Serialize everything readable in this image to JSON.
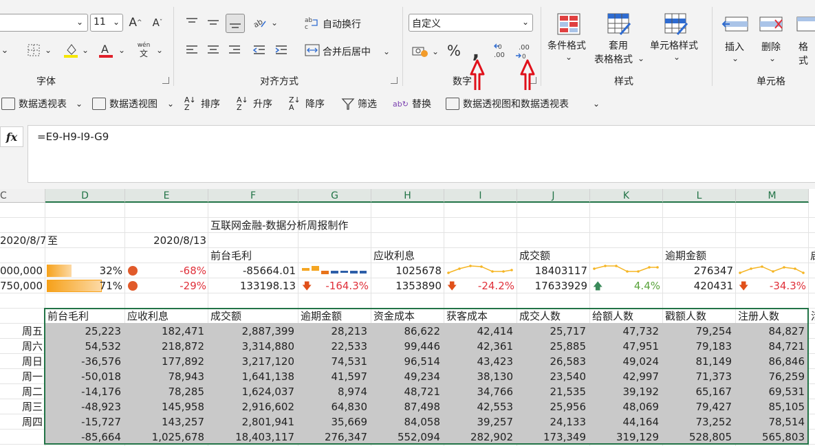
{
  "ribbon": {
    "font_size": "11",
    "font_group_label": "字体",
    "align_group_label": "对齐方式",
    "wrap_text": "自动换行",
    "merge_center": "合并后居中",
    "number_format": "自定义",
    "number_group_label": "数字",
    "percent_symbol": "%",
    "comma_symbol": ",",
    "inc_decimal": ".00",
    "dec_decimal": ".00",
    "wen_label": "wén",
    "cond_format": "条件格式",
    "table_format_1": "套用",
    "table_format_2": "表格格式",
    "cell_style": "单元格样式",
    "styles_group_label": "样式",
    "insert": "插入",
    "delete": "删除",
    "format": "格式",
    "cells_group_label": "单元格"
  },
  "quickbar": {
    "pivot_table": "数据透视表",
    "pivot_chart": "数据透视图",
    "sort": "排序",
    "asc": "升序",
    "desc": "降序",
    "filter": "筛选",
    "replace": "替换",
    "pivot_chart_and_table": "数据透视图和数据透视表"
  },
  "formula": {
    "fx": "fx",
    "text": "=E9-H9-I9-G9"
  },
  "columns": [
    "C",
    "D",
    "E",
    "F",
    "G",
    "H",
    "I",
    "J",
    "K",
    "L",
    "M"
  ],
  "sheet": {
    "title": "互联网金融-数据分析周报制作",
    "date_from": "2020/8/7",
    "to": "至",
    "date_to": "2020/8/13",
    "metric1": "前台毛利",
    "metric2": "应收利息",
    "metric3": "成交额",
    "metric4": "逾期金额",
    "metric5_partial": "启",
    "r1": {
      "c": "000,000",
      "d": "32%",
      "e": "-68%",
      "f": "-85664.01",
      "h": "1025678",
      "j": "18403117",
      "l": "276347"
    },
    "r2": {
      "c": "750,000",
      "d": "71%",
      "e": "-29%",
      "f": "133198.13",
      "g": "-164.3%",
      "h": "1353890",
      "i": "-24.2%",
      "j": "17633929",
      "k": "4.4%",
      "l": "420431",
      "m": "-34.3%"
    },
    "progress": {
      "d1": 0.32,
      "d2": 0.71
    },
    "headers": [
      "前台毛利",
      "应收利息",
      "成交额",
      "逾期金额",
      "资金成本",
      "获客成本",
      "成交人数",
      "给额人数",
      "戳额人数",
      "注册人数",
      "活"
    ],
    "rows": [
      {
        "day": "周五",
        "vals": [
          "25,223",
          "182,471",
          "2,887,399",
          "28,213",
          "86,622",
          "42,414",
          "25,717",
          "47,732",
          "79,254",
          "84,827"
        ]
      },
      {
        "day": "周六",
        "vals": [
          "54,532",
          "218,872",
          "3,314,880",
          "22,533",
          "99,446",
          "42,361",
          "25,885",
          "47,951",
          "79,183",
          "84,721"
        ]
      },
      {
        "day": "周日",
        "vals": [
          "-36,576",
          "177,892",
          "3,217,120",
          "74,531",
          "96,514",
          "43,423",
          "26,583",
          "49,024",
          "81,149",
          "86,846"
        ]
      },
      {
        "day": "周一",
        "vals": [
          "-50,018",
          "78,943",
          "1,641,138",
          "41,597",
          "49,234",
          "38,130",
          "23,540",
          "42,997",
          "71,373",
          "76,259"
        ]
      },
      {
        "day": "周二",
        "vals": [
          "-14,176",
          "78,285",
          "1,624,037",
          "8,974",
          "48,721",
          "34,766",
          "21,535",
          "39,192",
          "65,167",
          "69,531"
        ]
      },
      {
        "day": "周三",
        "vals": [
          "-48,923",
          "145,958",
          "2,916,602",
          "64,830",
          "87,498",
          "42,553",
          "25,956",
          "48,069",
          "79,427",
          "85,105"
        ]
      },
      {
        "day": "周四",
        "vals": [
          "-15,727",
          "143,257",
          "2,801,941",
          "35,669",
          "84,058",
          "39,257",
          "24,133",
          "44,164",
          "73,252",
          "78,514"
        ]
      },
      {
        "day": "",
        "vals": [
          "-85,664",
          "1,025,678",
          "18,403,117",
          "276,347",
          "552,094",
          "282,902",
          "173,349",
          "319,129",
          "528,805",
          "565,803"
        ]
      }
    ]
  }
}
